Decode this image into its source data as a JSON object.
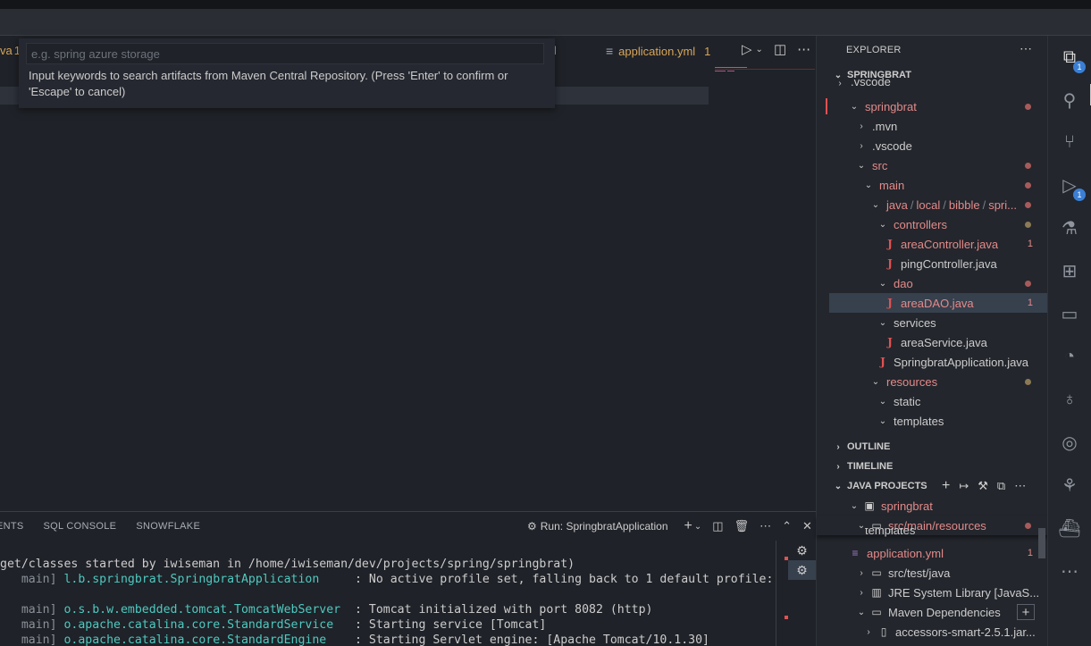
{
  "editor": {
    "tab_left_name": "va",
    "tab_left_count": "1",
    "tab_partial": "l",
    "tab_active_name": "application.yml",
    "tab_active_count": "1"
  },
  "quick_input": {
    "placeholder": "e.g. spring azure storage",
    "message": "Input keywords to search artifacts from Maven Central Repository. (Press 'Enter' to confirm or 'Escape' to cancel)"
  },
  "panel": {
    "tabs": [
      "ENTS",
      "SQL CONSOLE",
      "SNOWFLAKE"
    ],
    "run_label": "Run: SpringbratApplication",
    "terminal_lines": [
      {
        "prefix": "get/classes started by iwiseman in /home/iwiseman/dev/projects/spring/springbrat)",
        "logger": "",
        "message": ""
      },
      {
        "prefix": "   main] ",
        "logger": "l.b.springbrat.SpringbratApplication     ",
        "message": ": No active profile set, falling back to 1 default profile: "
      },
      {
        "prefix": "",
        "logger": "",
        "message": ""
      },
      {
        "prefix": "   main] ",
        "logger": "o.s.b.w.embedded.tomcat.TomcatWebServer  ",
        "message": ": Tomcat initialized with port 8082 (http)"
      },
      {
        "prefix": "   main] ",
        "logger": "o.apache.catalina.core.StandardService   ",
        "message": ": Starting service [Tomcat]"
      },
      {
        "prefix": "   main] ",
        "logger": "o.apache.catalina.core.StandardEngine    ",
        "message": ": Starting Servlet engine: [Apache Tomcat/10.1.30]"
      }
    ]
  },
  "sidebar": {
    "title": "EXPLORER",
    "root": "SPRINGBRAT",
    "tree": [
      {
        "label": ".vscode",
        "partial": true
      },
      {
        "label": "springbrat"
      },
      {
        "label": ".mvn"
      },
      {
        "label": ".vscode"
      },
      {
        "label": "src"
      },
      {
        "label": "main"
      },
      {
        "path": [
          "java",
          "local",
          "bibble",
          "spri..."
        ]
      },
      {
        "label": "controllers"
      },
      {
        "label": "areaController.java",
        "count": "1"
      },
      {
        "label": "pingController.java"
      },
      {
        "label": "dao"
      },
      {
        "label": "areaDAO.java",
        "count": "1"
      },
      {
        "label": "services"
      },
      {
        "label": "areaService.java"
      },
      {
        "label": "SpringbratApplication.java"
      },
      {
        "label": "resources"
      },
      {
        "label": "static"
      },
      {
        "label": "templates"
      }
    ],
    "outline": "OUTLINE",
    "timeline": "TIMELINE",
    "java_projects": "JAVA PROJECTS",
    "jp_tree": [
      {
        "label": "springbrat"
      },
      {
        "label": "src/main/resources"
      },
      {
        "label": "templates",
        "partial": true
      },
      {
        "label": "application.yml",
        "count": "1"
      },
      {
        "label": "src/test/java"
      },
      {
        "label": "JRE System Library [JavaS..."
      },
      {
        "label": "Maven Dependencies"
      },
      {
        "label": "accessors-smart-2.5.1.jar..."
      }
    ]
  },
  "activity": {
    "explorer_badge": "1",
    "debug_badge": "1",
    "icons": [
      "files-icon",
      "search-icon",
      "source-control-icon",
      "run-debug-icon",
      "testing-icon",
      "extensions-icon",
      "remote-explorer-icon",
      "gitlens-icon",
      "postgres-icon",
      "copilot-icon",
      "tree-icon",
      "docker-icon",
      "more-icon"
    ]
  },
  "colors": {
    "accent_red": "#e05252",
    "badge_blue": "#3a7fd4",
    "tab_yellow": "#d7a559",
    "cyan_logger": "#4ec9c0"
  }
}
